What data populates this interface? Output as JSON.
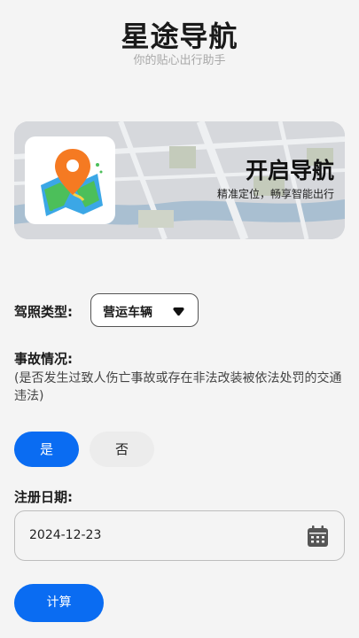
{
  "header": {
    "title": "星途导航",
    "subtitle": "你的贴心出行助手"
  },
  "banner": {
    "title": "开启导航",
    "subtitle": "精准定位，畅享智能出行",
    "logo_icon": "map-pin-icon"
  },
  "form": {
    "license": {
      "label": "驾照类型:",
      "value": "营运车辆",
      "icon": "caret-down-icon"
    },
    "accident": {
      "label": "事故情况:",
      "hint": "(是否发生过致人伤亡事故或存在非法改装被依法处罚的交通违法)",
      "yes_label": "是",
      "no_label": "否",
      "selected": "是"
    },
    "register": {
      "label": "注册日期:",
      "value": "2024-12-23",
      "icon": "calendar-icon"
    },
    "calculate_label": "计算"
  },
  "colors": {
    "primary": "#0a6cf2",
    "background": "#f4f4f4",
    "subtitle": "#a8a8a8"
  }
}
